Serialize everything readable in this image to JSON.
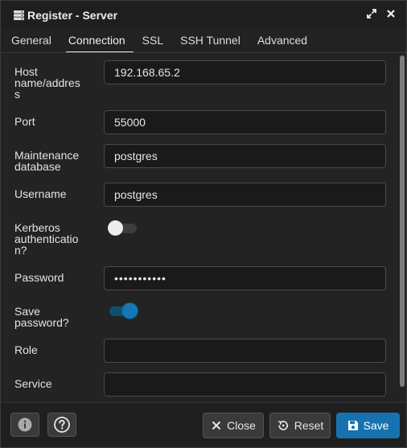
{
  "window": {
    "title": "Register - Server",
    "icons": {
      "app": "server-icon",
      "expand": "expand-icon",
      "close": "close-icon"
    }
  },
  "tabs": [
    {
      "label": "General",
      "active": false
    },
    {
      "label": "Connection",
      "active": true
    },
    {
      "label": "SSL",
      "active": false
    },
    {
      "label": "SSH Tunnel",
      "active": false
    },
    {
      "label": "Advanced",
      "active": false
    }
  ],
  "form": {
    "host": {
      "label_lines": [
        "Host",
        "name/addres",
        "s"
      ],
      "value": "192.168.65.2"
    },
    "port": {
      "label": "Port",
      "value": "55000"
    },
    "maintenance_db": {
      "label_lines": [
        "Maintenance",
        "database"
      ],
      "value": "postgres"
    },
    "username": {
      "label": "Username",
      "value": "postgres"
    },
    "kerberos": {
      "label_lines": [
        "Kerberos",
        "authenticatio",
        "n?"
      ],
      "enabled": false
    },
    "password": {
      "label": "Password",
      "value": "•••••••••••"
    },
    "save_password": {
      "label_lines": [
        "Save",
        "password?"
      ],
      "enabled": true
    },
    "role": {
      "label": "Role",
      "value": ""
    },
    "service": {
      "label": "Service",
      "value": ""
    }
  },
  "footer": {
    "info_icon": "info-icon",
    "help_icon": "help-icon",
    "close_label": "Close",
    "reset_label": "Reset",
    "save_label": "Save"
  },
  "colors": {
    "background": "#1f1f1f",
    "form_background": "#232323",
    "input_background": "#1a1a1a",
    "primary": "#1672ae",
    "toggle_on": "#1677b3"
  }
}
